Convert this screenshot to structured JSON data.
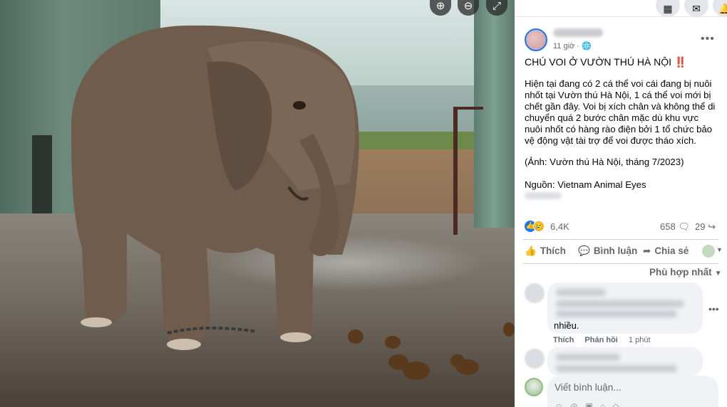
{
  "photo_controls": {
    "zoom_in": "⊕",
    "zoom_out": "⊖",
    "fullscreen": "⤢"
  },
  "topbar": {
    "menu_icon": "grid-menu-icon",
    "messenger_icon": "messenger-icon",
    "notifications_icon": "bell-icon"
  },
  "post": {
    "time": "11 giờ",
    "privacy_icon": "globe-icon",
    "more_label": "•••",
    "title": "CHÚ VOI Ở VƯỜN THÚ HÀ NỘI",
    "title_emoji": "‼️",
    "body": "Hiện tại đang có 2 cá thể voi cái đang bị nuôi nhốt tại Vườn thú Hà Nội, 1 cá thể voi mới bị chết gần đây. Voi bị xích chân và không thể di chuyển quá 2 bước chân mặc dù khu vực nuôi nhốt có hàng rào điện bởi 1 tổ chức bảo vệ động vật tài trợ để voi được tháo xích.",
    "credit": "(Ảnh: Vườn thú Hà Nội, tháng 7/2023)",
    "source": "Nguồn: Vietnam Animal Eyes"
  },
  "stats": {
    "reactions": "6,4K",
    "comments": "658",
    "shares": "29"
  },
  "actions": {
    "like": "Thích",
    "comment": "Bình luận",
    "share": "Chia sẻ"
  },
  "comments": {
    "sort_label": "Phù hợp nhất",
    "first_tail": "nhiều.",
    "like_label": "Thích",
    "reply_label": "Phản hồi",
    "first_time": "1 phút",
    "more_label": "•••"
  },
  "composer": {
    "placeholder": "Viết bình luận..."
  },
  "colors": {
    "brand_blue": "#1877f2",
    "reaction_sad": "#f7b125",
    "alert_red": "#e4253b"
  }
}
